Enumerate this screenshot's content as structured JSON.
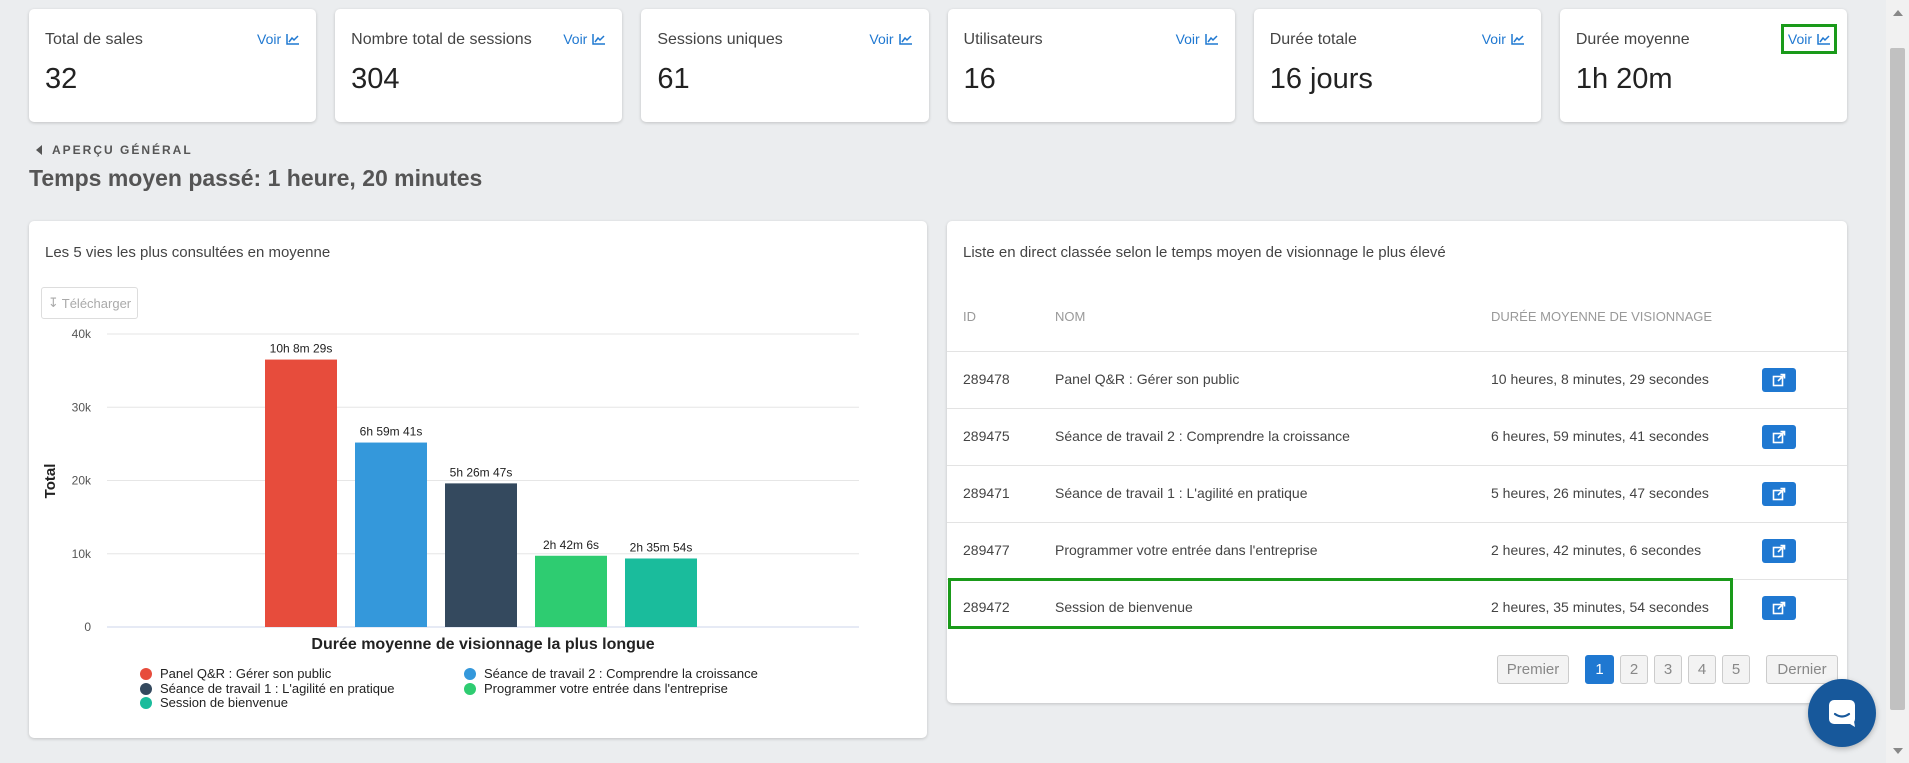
{
  "stats": [
    {
      "label": "Total de sales",
      "value": "32",
      "link": "Voir"
    },
    {
      "label": "Nombre total de sessions",
      "value": "304",
      "link": "Voir"
    },
    {
      "label": "Sessions uniques",
      "value": "61",
      "link": "Voir"
    },
    {
      "label": "Utilisateurs",
      "value": "16",
      "link": "Voir"
    },
    {
      "label": "Durée totale",
      "value": "16 jours",
      "link": "Voir"
    },
    {
      "label": "Durée moyenne",
      "value": "1h 20m",
      "link": "Voir"
    }
  ],
  "overview": {
    "crumb": "APERÇU GÉNÉRAL",
    "title": "Temps moyen passé: 1 heure, 20 minutes"
  },
  "chart_panel": {
    "title": "Les 5 vies les plus consultées en moyenne",
    "download_label": "Télécharger"
  },
  "chart_data": {
    "type": "bar",
    "title": "",
    "xlabel": "Durée moyenne de visionnage la plus longue",
    "ylabel": "Total",
    "ylim": [
      0,
      40000
    ],
    "yticks": [
      "0",
      "10k",
      "20k",
      "30k",
      "40k"
    ],
    "ytick_values": [
      0,
      10000,
      20000,
      30000,
      40000
    ],
    "grid": true,
    "legend_position": "bottom",
    "series": [
      {
        "name": "Panel Q&R : Gérer son public",
        "value": 36509,
        "label": "10h 8m 29s",
        "color": "#e74c3c"
      },
      {
        "name": "Séance de travail 2 : Comprendre la croissance",
        "value": 25181,
        "label": "6h 59m 41s",
        "color": "#3498db"
      },
      {
        "name": "Séance de travail 1 : L'agilité en pratique",
        "value": 19607,
        "label": "5h 26m 47s",
        "color": "#34495e"
      },
      {
        "name": "Programmer votre entrée dans l'entreprise",
        "value": 9726,
        "label": "2h 42m 6s",
        "color": "#2ecc71"
      },
      {
        "name": "Session de bienvenue",
        "value": 9354,
        "label": "2h 35m 54s",
        "color": "#1abc9c"
      }
    ]
  },
  "list_panel": {
    "title": "Liste en direct classée selon le temps moyen de visionnage le plus élevé",
    "headers": {
      "id": "ID",
      "name": "NOM",
      "duration": "DURÉE MOYENNE DE VISIONNAGE"
    },
    "rows": [
      {
        "id": "289478",
        "name": "Panel Q&R : Gérer son public",
        "duration": "10 heures, 8 minutes, 29 secondes"
      },
      {
        "id": "289475",
        "name": "Séance de travail 2 : Comprendre la croissance",
        "duration": "6 heures, 59 minutes, 41 secondes"
      },
      {
        "id": "289471",
        "name": "Séance de travail 1 : L'agilité en pratique",
        "duration": "5 heures, 26 minutes, 47 secondes"
      },
      {
        "id": "289477",
        "name": "Programmer votre entrée dans l'entreprise",
        "duration": "2 heures, 42 minutes, 6 secondes"
      },
      {
        "id": "289472",
        "name": "Session de bienvenue",
        "duration": "2 heures, 35 minutes, 54 secondes"
      }
    ],
    "pagination": {
      "first": "Premier",
      "pages": [
        "1",
        "2",
        "3",
        "4",
        "5"
      ],
      "active_page": "1",
      "last": "Dernier"
    }
  },
  "colors": {
    "accent": "#1f78d1",
    "highlight": "#1a9a1a",
    "chat": "#17589b"
  }
}
